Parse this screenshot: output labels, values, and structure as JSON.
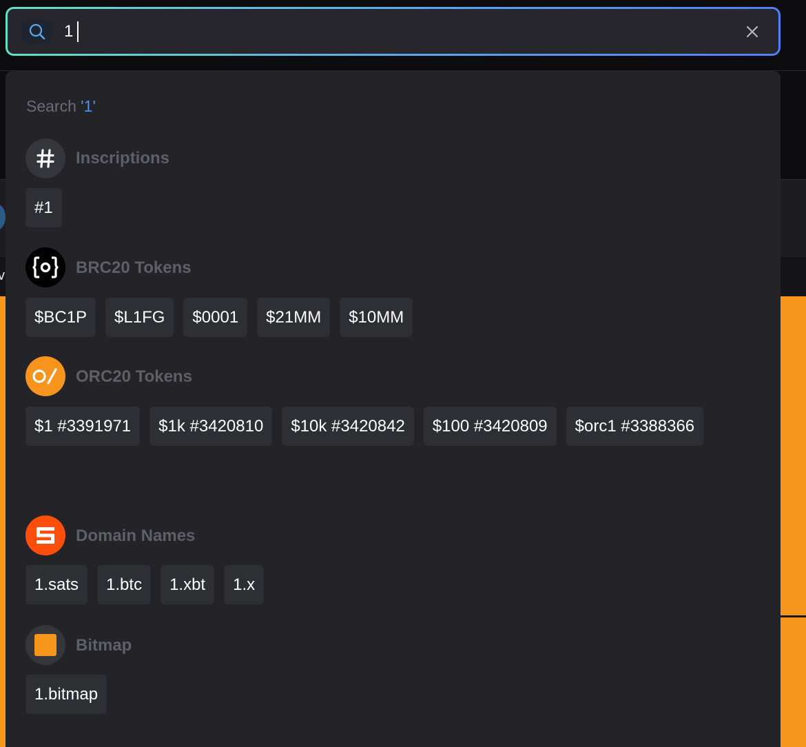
{
  "search": {
    "value": "1",
    "hint_prefix": "Search ",
    "hint_query": "'1'"
  },
  "icons": {
    "search": "search-icon",
    "clear": "close-icon"
  },
  "colors": {
    "accent_blue": "#4f8ff0",
    "accent_teal": "#64e0c6",
    "orc20_orange": "#f7941d",
    "domain_red": "#fd4e0c",
    "bitmap_orange": "#f7961c",
    "panel_bg": "#232328",
    "chip_bg": "#2e2e35"
  },
  "background": {
    "letter": "v"
  },
  "sections": [
    {
      "id": "inscriptions",
      "title": "Inscriptions",
      "icon": "hash-icon",
      "items": [
        "#1"
      ]
    },
    {
      "id": "brc20",
      "title": "BRC20 Tokens",
      "icon": "brc20-logo-icon",
      "items": [
        "$BC1P",
        "$L1FG",
        "$0001",
        "$21MM",
        "$10MM"
      ]
    },
    {
      "id": "orc20",
      "title": "ORC20 Tokens",
      "icon": "orc20-logo-icon",
      "items": [
        "$1 #3391971",
        "$1k #3420810",
        "$10k #3420842",
        "$100 #3420809",
        "$orc1 #3388366"
      ]
    },
    {
      "id": "domains",
      "title": "Domain Names",
      "icon": "sats-names-logo-icon",
      "items": [
        "1.sats",
        "1.btc",
        "1.xbt",
        "1.x"
      ]
    },
    {
      "id": "bitmap",
      "title": "Bitmap",
      "icon": "bitmap-square-icon",
      "items": [
        "1.bitmap"
      ]
    }
  ]
}
